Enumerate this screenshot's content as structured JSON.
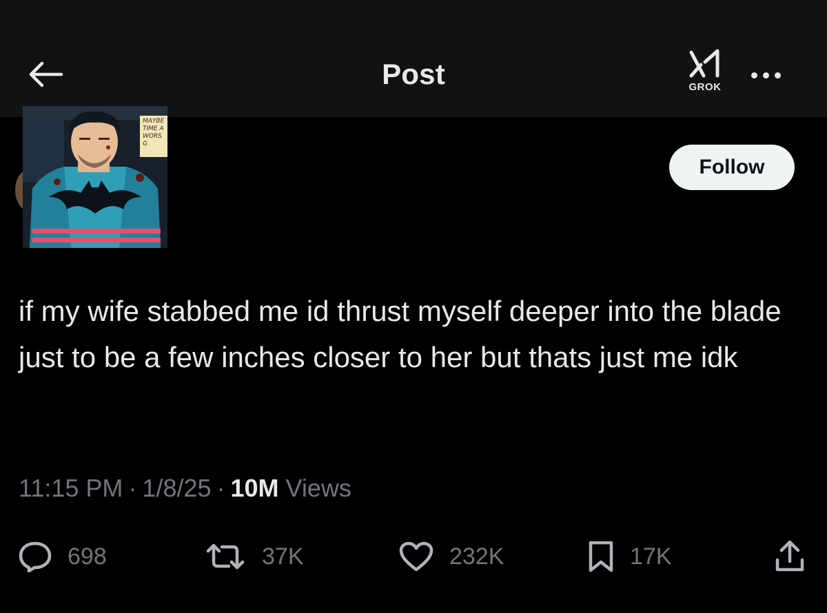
{
  "header": {
    "title": "Post",
    "grok_label": "GROK"
  },
  "avatar": {
    "caption": "MAYBE\nTIME A\nWORS\nG"
  },
  "follow_label": "Follow",
  "post": {
    "text": "if my wife stabbed me id thrust myself deeper into the blade just to be a few inches closer to her but thats just me idk"
  },
  "meta": {
    "time": "11:15 PM",
    "separator": "·",
    "date": "1/8/25",
    "views_count": "10M",
    "views_label": "Views"
  },
  "actions": {
    "replies": "698",
    "reposts": "37K",
    "likes": "232K",
    "bookmarks": "17K"
  },
  "colors": {
    "background": "#000000",
    "header_bg": "#111214",
    "text_primary": "#e7e9ea",
    "text_secondary": "#71767b",
    "follow_bg": "#eff3f4"
  }
}
